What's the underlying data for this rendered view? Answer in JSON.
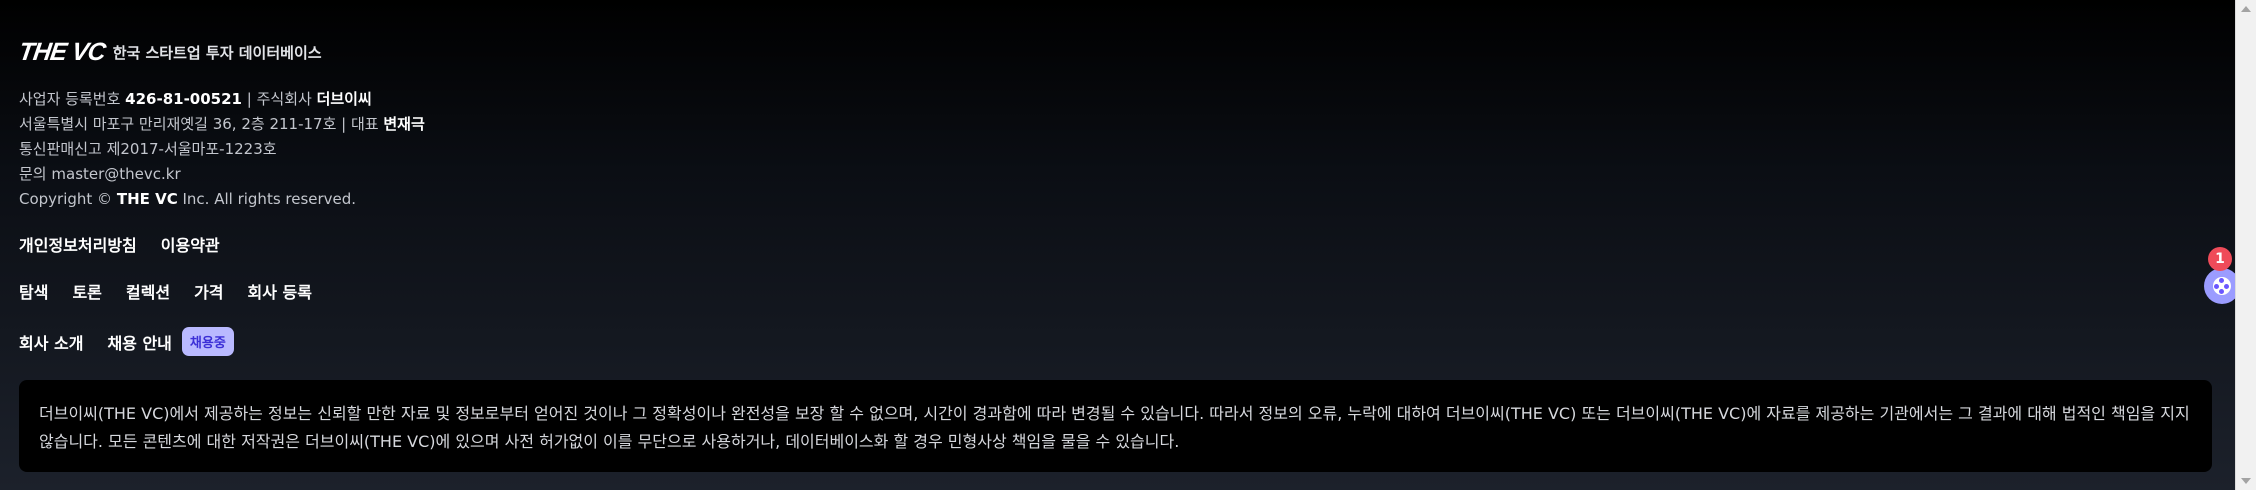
{
  "brand": {
    "logo": "THE VC",
    "tagline": "한국 스타트업 투자 데이터베이스"
  },
  "company_info": {
    "reg_label": "사업자 등록번호",
    "reg_number": "426-81-00521",
    "company_label": "| 주식회사",
    "company_name": "더브이씨",
    "address": "서울특별시 마포구 만리재옛길 36, 2층 211-17호 | 대표",
    "ceo": "변재극",
    "telecom": "통신판매신고 제2017-서울마포-1223호",
    "contact_label": "문의",
    "contact_email": "master@thevc.kr",
    "copyright_prefix": "Copyright ©",
    "copyright_company": "THE VC",
    "copyright_suffix": "Inc. All rights reserved."
  },
  "links": {
    "privacy": "개인정보처리방침",
    "terms": "이용약관",
    "explore": "탐색",
    "discussion": "토론",
    "collection": "컬렉션",
    "pricing": "가격",
    "company_register": "회사 등록",
    "about": "회사 소개",
    "recruit": "채용 안내",
    "recruit_badge": "채용중"
  },
  "notice": "더브이씨(THE VC)에서 제공하는 정보는 신뢰할 만한 자료 및 정보로부터 얻어진 것이나 그 정확성이나 완전성을 보장 할 수 없으며, 시간이 경과함에 따라 변경될 수 있습니다. 따라서 정보의 오류, 누락에 대하여 더브이씨(THE VC) 또는 더브이씨(THE VC)에 자료를 제공하는 기관에서는 그 결과에 대해 법적인 책임을 지지 않습니다. 모든 콘텐츠에 대한 저작권은 더브이씨(THE VC)에 있으며 사전 허가없이 이를 무단으로 사용하거나, 데이터베이스화 할 경우 민형사상 책임을 물을 수 있습니다.",
  "chat": {
    "unread_count": "1"
  },
  "colors": {
    "accent": "#b9b9ff",
    "badge_text": "#3b2fd6",
    "chat_badge": "#ef4b59"
  }
}
